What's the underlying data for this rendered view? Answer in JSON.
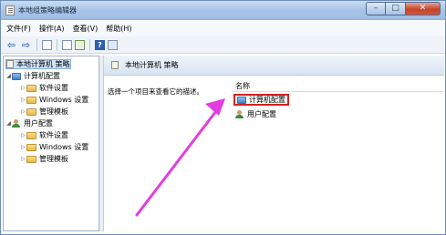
{
  "window": {
    "title": "本地组策略编辑器",
    "controls": {
      "minimize": "–",
      "maximize": "□",
      "close": "✕"
    }
  },
  "menu": [
    "文件(F)",
    "操作(A)",
    "查看(V)",
    "帮助(H)"
  ],
  "toolbar": {
    "icons": [
      "back-arrow-icon",
      "forward-arrow-icon",
      "show-tree-icon",
      "properties-icon",
      "export-icon",
      "help-icon",
      "console-icon"
    ],
    "help_glyph": "?"
  },
  "tree": {
    "root": "本地计算机 策略",
    "computer": "计算机配置",
    "computer_children": [
      "软件设置",
      "Windows 设置",
      "管理模板"
    ],
    "user": "用户配置",
    "user_children": [
      "软件设置",
      "Windows 设置",
      "管理模板"
    ]
  },
  "right_pane": {
    "header": "本地计算机 策略",
    "description": "选择一个项目来查看它的描述。",
    "column_name": "名称",
    "items": [
      "计算机配置",
      "用户配置"
    ]
  },
  "colors": {
    "highlight_box": "#d62020",
    "annotation_arrow": "#e23de0"
  }
}
